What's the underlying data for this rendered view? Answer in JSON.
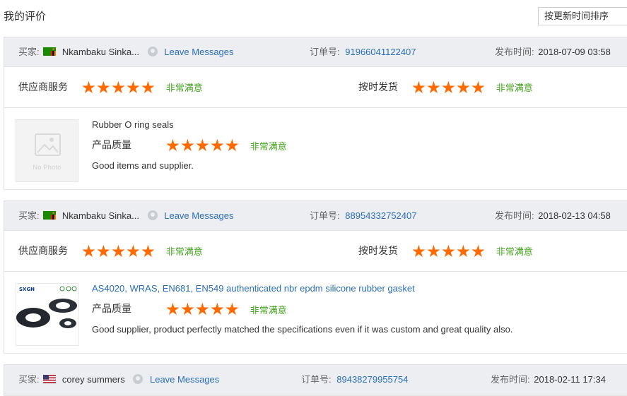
{
  "page": {
    "title": "我的评价",
    "sort_label": "按更新时间排序"
  },
  "colors": {
    "star": "#ff6a00",
    "satisfied": "#44a31e",
    "link": "#2a6ebb",
    "header_bg": "#eceef1"
  },
  "labels": {
    "buyer": "买家:",
    "leave_messages": "Leave Messages",
    "order_no": "订单号:",
    "published": "发布时间:",
    "supplier_service": "供应商服务",
    "on_time_delivery": "按时发货",
    "product_quality": "产品质量",
    "no_photo": "No Photo"
  },
  "reviews": [
    {
      "buyer_name": "Nkambaku Sinka...",
      "flag": "zambia-flag-icon",
      "order_no": "91966041122407",
      "published": "2018-07-09 03:58",
      "supplier_service": {
        "stars": 5,
        "text": "非常满意"
      },
      "on_time_delivery": {
        "stars": 5,
        "text": "非常满意"
      },
      "product": {
        "title": "Rubber O ring seals",
        "title_is_link": false,
        "image": "no-photo-placeholder",
        "quality": {
          "stars": 5,
          "text": "非常满意"
        },
        "comment": "Good items and supplier."
      }
    },
    {
      "buyer_name": "Nkambaku Sinka...",
      "flag": "zambia-flag-icon",
      "order_no": "88954332752407",
      "published": "2018-02-13 04:58",
      "supplier_service": {
        "stars": 5,
        "text": "非常满意"
      },
      "on_time_delivery": {
        "stars": 5,
        "text": "非常满意"
      },
      "product": {
        "title": "AS4020, WRAS, EN681, EN549 authenticated nbr epdm silicone rubber gasket",
        "title_is_link": true,
        "image": "rubber-gasket-photo",
        "quality": {
          "stars": 5,
          "text": "非常满意"
        },
        "comment": "Good supplier, product perfectly matched the specifications even if it was custom and great quality also."
      }
    },
    {
      "buyer_name": "corey summers",
      "flag": "usa-flag-icon",
      "order_no": "89438279955754",
      "published": "2018-02-11 17:34"
    }
  ]
}
